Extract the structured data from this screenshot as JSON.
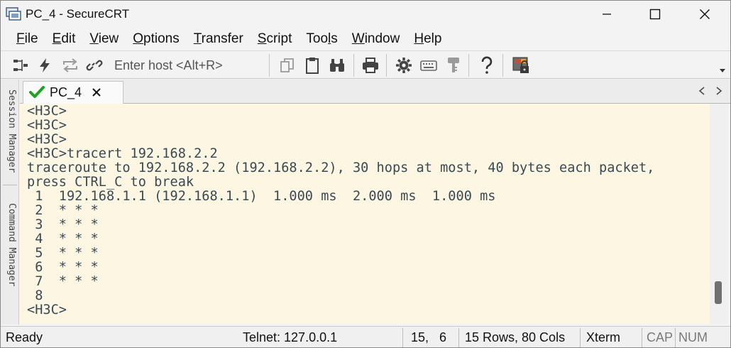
{
  "window": {
    "title": "PC_4 - SecureCRT"
  },
  "menu": {
    "items": [
      {
        "accel": "F",
        "rest": "ile"
      },
      {
        "accel": "E",
        "rest": "dit"
      },
      {
        "accel": "V",
        "rest": "iew"
      },
      {
        "accel": "O",
        "rest": "ptions"
      },
      {
        "accel": "T",
        "rest": "ransfer"
      },
      {
        "accel": "S",
        "rest": "cript"
      },
      {
        "pre": "Too",
        "accel": "l",
        "rest": "s"
      },
      {
        "accel": "W",
        "rest": "indow"
      },
      {
        "accel": "H",
        "rest": "elp"
      }
    ]
  },
  "toolbar": {
    "host_placeholder": "Enter host <Alt+R>"
  },
  "side_panels": {
    "session_manager": "Session Manager",
    "command_manager": "Command Manager"
  },
  "tabs": {
    "active_label": "PC_4",
    "close_glyph": "×"
  },
  "terminal": {
    "lines": [
      "<H3C>",
      "<H3C>",
      "<H3C>",
      "<H3C>tracert 192.168.2.2",
      "traceroute to 192.168.2.2 (192.168.2.2), 30 hops at most, 40 bytes each packet,",
      "press CTRL_C to break",
      " 1  192.168.1.1 (192.168.1.1)  1.000 ms  2.000 ms  1.000 ms",
      " 2  * * *",
      " 3  * * *",
      " 4  * * *",
      " 5  * * *",
      " 6  * * *",
      " 7  * * *",
      " 8",
      "<H3C>"
    ]
  },
  "statusbar": {
    "status": "Ready",
    "connection": "Telnet: 127.0.0.1",
    "cursor_row": "15,",
    "cursor_col": "6",
    "dimensions": "15 Rows, 80 Cols",
    "terminal_type": "Xterm",
    "caps": "CAP",
    "num": "NUM"
  },
  "colors": {
    "terminal_bg": "#fdf6e3",
    "terminal_fg": "#3a4a52",
    "tab_check": "#1fa31f"
  }
}
